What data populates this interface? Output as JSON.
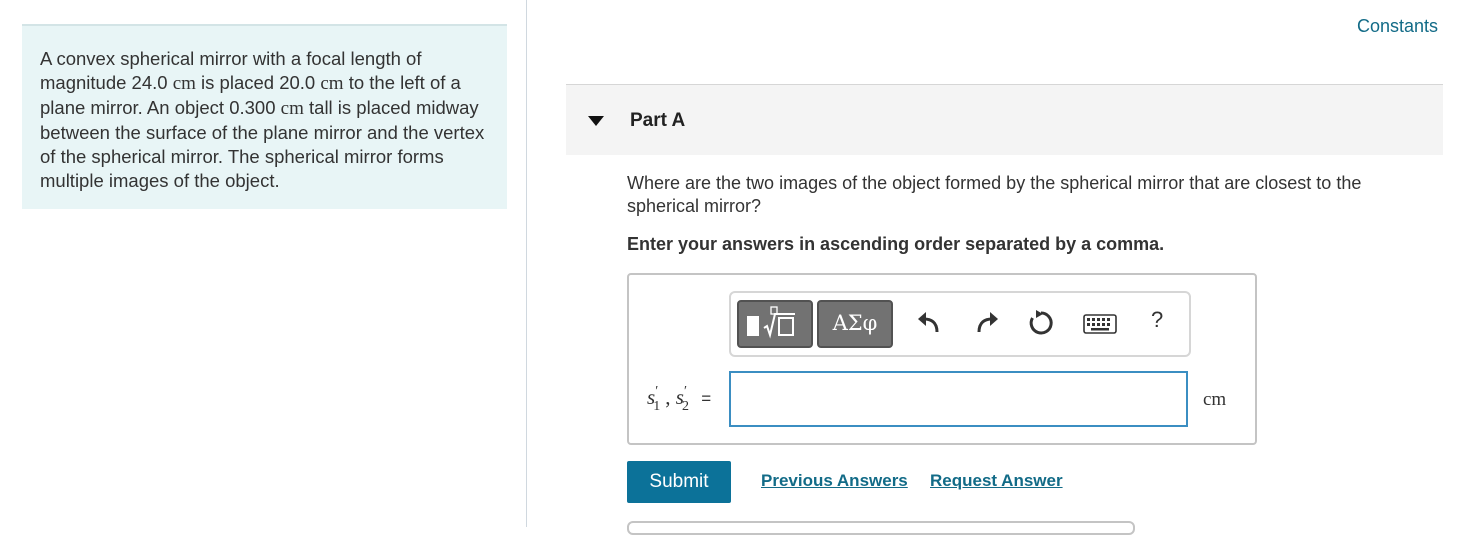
{
  "problem": {
    "segments": [
      {
        "t": "A convex spherical mirror with a focal length of magnitude 24.0 ",
        "math": false
      },
      {
        "t": "cm",
        "math": true
      },
      {
        "t": " is placed 20.0 ",
        "math": false
      },
      {
        "t": "cm",
        "math": true
      },
      {
        "t": " to the left of a plane mirror. An object 0.300 ",
        "math": false
      },
      {
        "t": "cm",
        "math": true
      },
      {
        "t": " tall is placed midway between the surface of the plane mirror and the vertex of the spherical mirror. The spherical mirror forms multiple images of the object.",
        "math": false
      }
    ]
  },
  "header": {
    "constants_link": "Constants"
  },
  "part": {
    "title": "Part A",
    "question": "Where are the two images of the object formed by the spherical mirror that are closest to the spherical mirror?",
    "instruction": "Enter your answers in ascending order separated by a comma."
  },
  "toolbar": {
    "greek_label": "ΑΣφ",
    "help_label": "?",
    "icons": [
      "templates-icon",
      "greek-symbols-icon",
      "undo-icon",
      "redo-icon",
      "reset-icon",
      "keyboard-icon",
      "help-icon"
    ]
  },
  "answer": {
    "formula": {
      "s": "s",
      "prime": "′",
      "sub1": "1",
      "sep": ", ",
      "sub2": "2",
      "eq": "="
    },
    "value": "",
    "unit": "cm"
  },
  "actions": {
    "submit_label": "Submit",
    "previous_answers": "Previous Answers",
    "request_answer": "Request Answer"
  },
  "colors": {
    "link": "#126b87",
    "submit_bg": "#0c7299",
    "panel_bg": "#e8f5f6",
    "input_border": "#3b8ec2"
  }
}
